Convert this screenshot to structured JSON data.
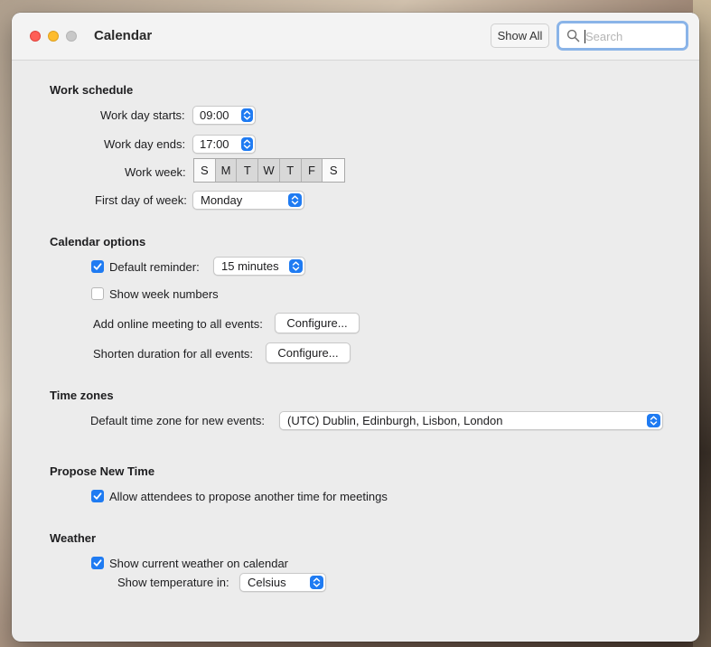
{
  "window": {
    "title": "Calendar",
    "show_all_label": "Show All",
    "search_placeholder": "Search"
  },
  "work_schedule": {
    "heading": "Work schedule",
    "start_label": "Work day starts:",
    "start_value": "09:00",
    "end_label": "Work day ends:",
    "end_value": "17:00",
    "week_label": "Work week:",
    "days": [
      {
        "letter": "S",
        "selected": false
      },
      {
        "letter": "M",
        "selected": true
      },
      {
        "letter": "T",
        "selected": true
      },
      {
        "letter": "W",
        "selected": true
      },
      {
        "letter": "T",
        "selected": true
      },
      {
        "letter": "F",
        "selected": true
      },
      {
        "letter": "S",
        "selected": false
      }
    ],
    "first_day_label": "First day of week:",
    "first_day_value": "Monday"
  },
  "calendar_options": {
    "heading": "Calendar options",
    "default_reminder_label": "Default reminder:",
    "default_reminder_checked": true,
    "default_reminder_value": "15 minutes",
    "week_numbers_label": "Show week numbers",
    "week_numbers_checked": false,
    "online_meeting_label": "Add online meeting to all events:",
    "online_meeting_button": "Configure...",
    "shorten_label": "Shorten duration for all events:",
    "shorten_button": "Configure..."
  },
  "time_zones": {
    "heading": "Time zones",
    "default_label": "Default time zone for new events:",
    "default_value": "(UTC) Dublin, Edinburgh, Lisbon, London"
  },
  "propose_new_time": {
    "heading": "Propose New Time",
    "allow_label": "Allow attendees to propose another time for meetings",
    "allow_checked": true
  },
  "weather": {
    "heading": "Weather",
    "show_label": "Show current weather on calendar",
    "show_checked": true,
    "temp_label": "Show temperature in:",
    "temp_value": "Celsius"
  },
  "colors": {
    "accent": "#1f7bf2",
    "close": "#ff5f57",
    "minimize": "#febc2e",
    "zoom": "#c8c8c8"
  }
}
